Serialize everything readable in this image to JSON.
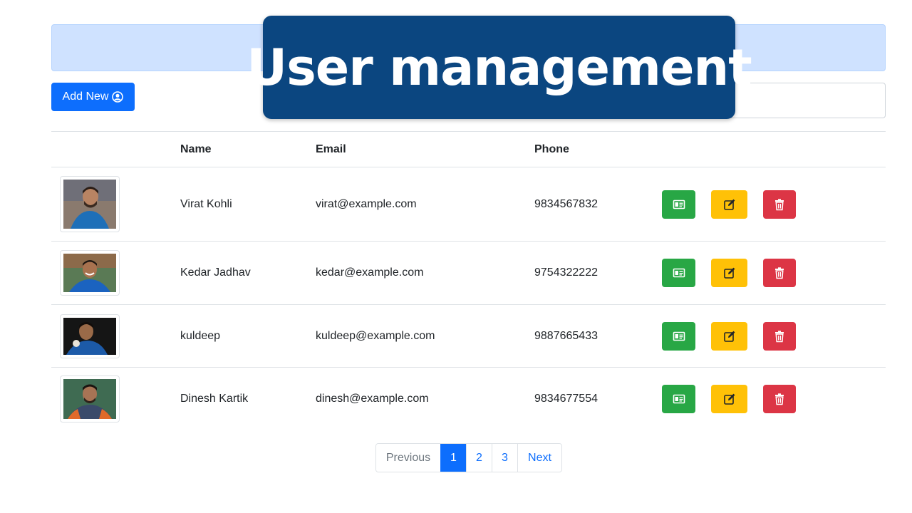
{
  "title_banner": "User management",
  "toolbar": {
    "add_label": "Add New",
    "search_placeholder": ""
  },
  "table": {
    "headers": [
      "",
      "Name",
      "Email",
      "Phone",
      ""
    ],
    "rows": [
      {
        "name": "Virat Kohli",
        "email": "virat@example.com",
        "phone": "9834567832"
      },
      {
        "name": "Kedar Jadhav",
        "email": "kedar@example.com",
        "phone": "9754322222"
      },
      {
        "name": "kuldeep",
        "email": "kuldeep@example.com",
        "phone": "9887665433"
      },
      {
        "name": "Dinesh Kartik",
        "email": "dinesh@example.com",
        "phone": "9834677554"
      }
    ]
  },
  "icons": {
    "add": "user-circle-icon",
    "view": "id-card-icon",
    "edit": "pencil-square-icon",
    "delete": "trash-icon"
  },
  "pagination": {
    "previous": "Previous",
    "pages": [
      "1",
      "2",
      "3"
    ],
    "active_page": "1",
    "next": "Next"
  },
  "colors": {
    "primary": "#0d6efd",
    "header_bar": "#cfe2ff",
    "banner": "#0b4680",
    "view": "#28a745",
    "edit": "#ffc107",
    "delete": "#dc3545"
  }
}
